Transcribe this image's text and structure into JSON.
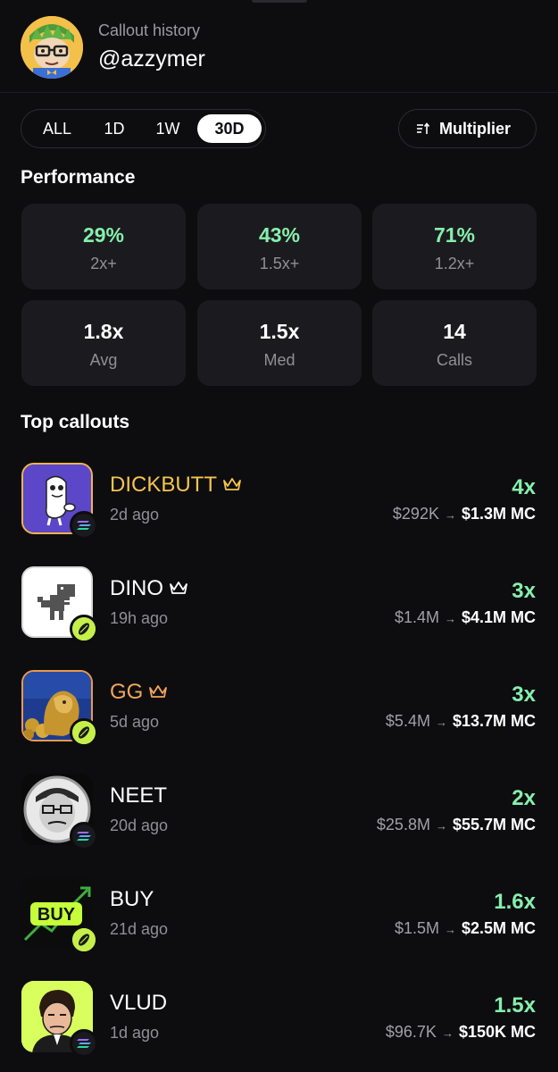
{
  "header": {
    "subtitle": "Callout history",
    "username": "@azzymer"
  },
  "tabs": [
    {
      "label": "ALL",
      "active": false
    },
    {
      "label": "1D",
      "active": false
    },
    {
      "label": "1W",
      "active": false
    },
    {
      "label": "30D",
      "active": true
    }
  ],
  "multiplier_button": {
    "label": "Multiplier",
    "icon": "sort-icon"
  },
  "performance": {
    "title": "Performance",
    "stats": [
      {
        "value": "29%",
        "label": "2x+",
        "accent": "green"
      },
      {
        "value": "43%",
        "label": "1.5x+",
        "accent": "green"
      },
      {
        "value": "71%",
        "label": "1.2x+",
        "accent": "green"
      },
      {
        "value": "1.8x",
        "label": "Avg",
        "accent": "white"
      },
      {
        "value": "1.5x",
        "label": "Med",
        "accent": "white"
      },
      {
        "value": "14",
        "label": "Calls",
        "accent": "white"
      }
    ]
  },
  "top_callouts": {
    "title": "Top callouts",
    "items": [
      {
        "name": "DICKBUTT",
        "crown": true,
        "name_color": "#f4c44e",
        "age": "2d ago",
        "multiplier": "4x",
        "from": "$292K",
        "arrow": "→",
        "to": "$1.3M MC",
        "chain": "solana-icon"
      },
      {
        "name": "DINO",
        "crown": true,
        "name_color": "#ffffff",
        "age": "19h ago",
        "multiplier": "3x",
        "from": "$1.4M",
        "arrow": "→",
        "to": "$4.1M MC",
        "chain": "pump-icon"
      },
      {
        "name": "GG",
        "crown": true,
        "name_color": "#f2a65a",
        "age": "5d ago",
        "multiplier": "3x",
        "from": "$5.4M",
        "arrow": "→",
        "to": "$13.7M MC",
        "chain": "pump-icon"
      },
      {
        "name": "NEET",
        "crown": false,
        "name_color": "#ffffff",
        "age": "20d ago",
        "multiplier": "2x",
        "from": "$25.8M",
        "arrow": "→",
        "to": "$55.7M MC",
        "chain": "solana-icon"
      },
      {
        "name": "BUY",
        "crown": false,
        "name_color": "#ffffff",
        "age": "21d ago",
        "multiplier": "1.6x",
        "from": "$1.5M",
        "arrow": "→",
        "to": "$2.5M MC",
        "chain": "pump-icon"
      },
      {
        "name": "VLUD",
        "crown": false,
        "name_color": "#ffffff",
        "age": "1d ago",
        "multiplier": "1.5x",
        "from": "$96.7K",
        "arrow": "→",
        "to": "$150K MC",
        "chain": "solana-icon"
      }
    ]
  },
  "logo_texts": {
    "buy_logo": "BUY"
  },
  "colors": {
    "background": "#0d0d10",
    "card": "#1b1b1f",
    "green": "#86efac",
    "muted": "#8f8f96"
  }
}
